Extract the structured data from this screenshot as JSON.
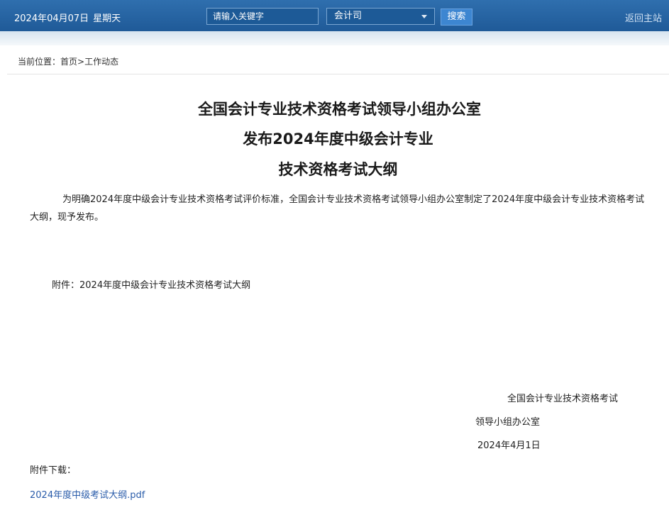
{
  "header": {
    "date": "2024年04月07日",
    "weekday": "星期天",
    "search": {
      "placeholder": "请输入关键字"
    },
    "department": {
      "selected": "会计司"
    },
    "search_button": "搜索",
    "home_link": "返回主站"
  },
  "breadcrumb": {
    "prefix": "当前位置：",
    "home": "首页",
    "separator": ">",
    "current": "工作动态"
  },
  "article": {
    "title_lines": [
      "全国会计专业技术资格考试领导小组办公室",
      "发布2024年度中级会计专业",
      "技术资格考试大纲"
    ],
    "body": "为明确2024年度中级会计专业技术资格考试评价标准，全国会计专业技术资格考试领导小组办公室制定了2024年度中级会计专业技术资格考试大纲，现予发布。",
    "attachment_note": "附件：2024年度中级会计专业技术资格考试大纲",
    "signature": {
      "line1": "全国会计专业技术资格考试",
      "line2": "领导小组办公室",
      "date": "2024年4月1日"
    },
    "downloads": {
      "label": "附件下载：",
      "file": "2024年度中级考试大纲.pdf"
    }
  },
  "colors": {
    "topbar": "#1f5a98",
    "button": "#3d86d1",
    "link": "#2a5caa"
  }
}
